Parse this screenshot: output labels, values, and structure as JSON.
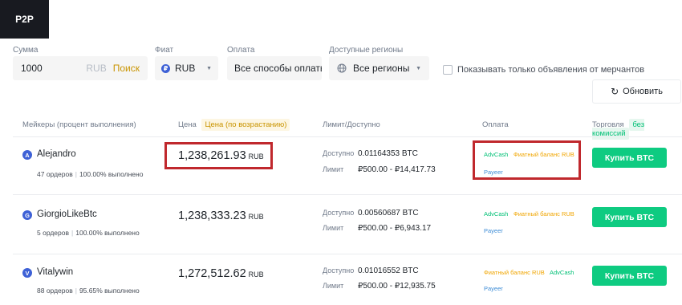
{
  "header": {
    "tab_p2p": "P2P"
  },
  "filters": {
    "amount_label": "Сумма",
    "amount_value": "1000",
    "amount_currency": "RUB",
    "search_label": "Поиск",
    "fiat_label": "Фиат",
    "fiat_value": "RUB",
    "fiat_icon_letter": "₽",
    "payment_label": "Оплата",
    "payment_value": "Все способы оплаты",
    "regions_label": "Доступные регионы",
    "regions_value": "Все регионы",
    "merchant_only_label": "Показывать только объявления от мерчантов",
    "refresh_label": "Обновить"
  },
  "table": {
    "col_makers": "Мейкеры (процент выполнения)",
    "col_price": "Цена",
    "col_price_badge": "Цена (по возрастанию)",
    "col_limit": "Лимит/Доступно",
    "col_payment": "Оплата",
    "col_trade": "Торговля",
    "col_trade_badge": "без комиссий",
    "available_label": "Доступно",
    "limit_label": "Лимит",
    "rows": [
      {
        "avatar": "A",
        "name": "Alejandro",
        "orders": "47 ордеров",
        "completion": "100.00% выполнено",
        "price": "1,238,261.93",
        "price_unit": "RUB",
        "available": "0.01164353 BTC",
        "limit": "₽500.00 - ₽14,417.73",
        "payments": [
          "AdvCash",
          "Фиатный баланс RUB",
          "Payeer"
        ],
        "buy_label": "Купить BTC"
      },
      {
        "avatar": "G",
        "name": "GiorgioLikeBtc",
        "orders": "5 ордеров",
        "completion": "100.00% выполнено",
        "price": "1,238,333.23",
        "price_unit": "RUB",
        "available": "0.00560687 BTC",
        "limit": "₽500.00 - ₽6,943.17",
        "payments": [
          "AdvCash",
          "Фиатный баланс RUB",
          "Payeer"
        ],
        "buy_label": "Купить BTC"
      },
      {
        "avatar": "V",
        "name": "Vitalywin",
        "orders": "88 ордеров",
        "completion": "95.65% выполнено",
        "price": "1,272,512.62",
        "price_unit": "RUB",
        "available": "0.01016552 BTC",
        "limit": "₽500.00 - ₽12,935.75",
        "payments": [
          "Фиатный баланс RUB",
          "AdvCash",
          "Payeer"
        ],
        "buy_label": "Купить BTC"
      }
    ]
  },
  "colors": {
    "accent_yellow": "#c99400",
    "buy_green": "#0ecb81",
    "highlight_red": "#c0282d",
    "tab_dark": "#181a20"
  }
}
